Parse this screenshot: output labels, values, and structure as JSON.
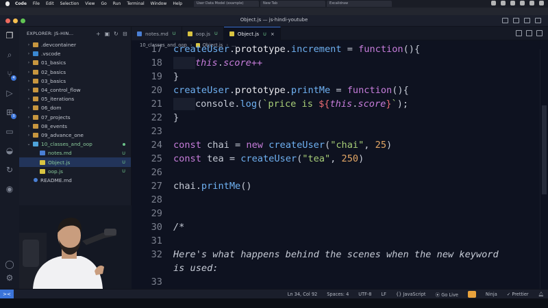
{
  "menubar": {
    "app": "Code",
    "items": [
      "File",
      "Edit",
      "Selection",
      "View",
      "Go",
      "Run",
      "Terminal",
      "Window",
      "Help"
    ],
    "browser_tabs": [
      "User Data Model (example)",
      "New Tab",
      "Excalidraw"
    ]
  },
  "window": {
    "title": "Object.js — js-hindi-youtube"
  },
  "colors": {
    "accent": "#3b74d9",
    "modified": "#6cc38a",
    "keyword": "#c77ddb",
    "function": "#6fb1f2",
    "string": "#a8cf78",
    "number": "#e3a765"
  },
  "activity": {
    "source_control_badge": "4",
    "extensions_badge": "3"
  },
  "explorer": {
    "title": "EXPLORER: JS-HIN...",
    "items": [
      {
        "label": ".devcontainer",
        "kind": "folder",
        "depth": 0
      },
      {
        "label": ".vscode",
        "kind": "folder-vscode",
        "depth": 0
      },
      {
        "label": "01_basics",
        "kind": "folder",
        "depth": 0
      },
      {
        "label": "02_basics",
        "kind": "folder",
        "depth": 0
      },
      {
        "label": "03_basics",
        "kind": "folder",
        "depth": 0
      },
      {
        "label": "04_control_flow",
        "kind": "folder",
        "depth": 0
      },
      {
        "label": "05_iterations",
        "kind": "folder",
        "depth": 0
      },
      {
        "label": "06_dom",
        "kind": "folder",
        "depth": 0
      },
      {
        "label": "07_projects",
        "kind": "folder",
        "depth": 0
      },
      {
        "label": "08_events",
        "kind": "folder",
        "depth": 0
      },
      {
        "label": "09_advance_one",
        "kind": "folder",
        "depth": 0
      },
      {
        "label": "10_classes_and_oop",
        "kind": "folder-open",
        "depth": 0
      },
      {
        "label": "notes.md",
        "kind": "md",
        "depth": 1,
        "status": "U"
      },
      {
        "label": "Object.js",
        "kind": "js",
        "depth": 1,
        "status": "U"
      },
      {
        "label": "oop.js",
        "kind": "js",
        "depth": 1,
        "status": "U"
      },
      {
        "label": "README.md",
        "kind": "readme",
        "depth": 0
      }
    ]
  },
  "tabs": [
    {
      "label": "notes.md",
      "status": "U"
    },
    {
      "label": "oop.js",
      "status": "U"
    },
    {
      "label": "Object.js",
      "status": "U",
      "close": "×"
    }
  ],
  "breadcrumb": {
    "folder": "10_classes_and_oop",
    "file": "Object.js",
    "more": "..."
  },
  "editor": {
    "lines": [
      {
        "n": "17",
        "tokens": [
          [
            "fn",
            "createUser"
          ],
          [
            "p",
            "."
          ],
          [
            "prop",
            "prototype"
          ],
          [
            "p",
            "."
          ],
          [
            "fn",
            "increment"
          ],
          [
            "p",
            " = "
          ],
          [
            "kw",
            "function"
          ],
          [
            "p",
            "(){"
          ]
        ]
      },
      {
        "n": "18",
        "indent": 1,
        "tokens": [
          [
            "this",
            "this"
          ],
          [
            "p",
            "."
          ],
          [
            "cmtit",
            "score++"
          ]
        ]
      },
      {
        "n": "19",
        "tokens": [
          [
            "p",
            "}"
          ]
        ]
      },
      {
        "n": "20",
        "tokens": [
          [
            "fn",
            "createUser"
          ],
          [
            "p",
            "."
          ],
          [
            "prop",
            "prototype"
          ],
          [
            "p",
            "."
          ],
          [
            "fn",
            "printMe"
          ],
          [
            "p",
            " = "
          ],
          [
            "kw",
            "function"
          ],
          [
            "p",
            "(){"
          ]
        ]
      },
      {
        "n": "21",
        "indent": 1,
        "tokens": [
          [
            "p",
            "console."
          ],
          [
            "fn",
            "log"
          ],
          [
            "p",
            "("
          ],
          [
            "str",
            "`price is "
          ],
          [
            "var",
            "${"
          ],
          [
            "this",
            "this"
          ],
          [
            "p",
            "."
          ],
          [
            "cmtit",
            "score"
          ],
          [
            "var",
            "}"
          ],
          [
            "str",
            "`"
          ],
          [
            "p",
            ");"
          ]
        ]
      },
      {
        "n": "22",
        "tokens": [
          [
            "p",
            "}"
          ]
        ]
      },
      {
        "n": "23",
        "tokens": []
      },
      {
        "n": "24",
        "tokens": [
          [
            "kw",
            "const "
          ],
          [
            "p",
            "chai = "
          ],
          [
            "kw",
            "new "
          ],
          [
            "fn",
            "createUser"
          ],
          [
            "p",
            "("
          ],
          [
            "str",
            "\"chai\""
          ],
          [
            "p",
            ", "
          ],
          [
            "num",
            "25"
          ],
          [
            "p",
            ")"
          ]
        ]
      },
      {
        "n": "25",
        "tokens": [
          [
            "kw",
            "const "
          ],
          [
            "p",
            "tea = "
          ],
          [
            "fn",
            "createUser"
          ],
          [
            "p",
            "("
          ],
          [
            "str",
            "\"tea\""
          ],
          [
            "p",
            ", "
          ],
          [
            "num",
            "250"
          ],
          [
            "p",
            ")"
          ]
        ]
      },
      {
        "n": "26",
        "tokens": []
      },
      {
        "n": "27",
        "tokens": [
          [
            "p",
            "chai."
          ],
          [
            "fn",
            "printMe"
          ],
          [
            "p",
            "()"
          ]
        ]
      },
      {
        "n": "28",
        "tokens": []
      },
      {
        "n": "29",
        "tokens": []
      },
      {
        "n": "30",
        "tokens": [
          [
            "cmt",
            "/*"
          ]
        ]
      },
      {
        "n": "31",
        "tokens": []
      },
      {
        "n": "32",
        "tokens": [
          [
            "cmt",
            "Here's what happens behind the scenes when the new keyword"
          ]
        ]
      },
      {
        "n": "",
        "tokens": [
          [
            "cmt",
            "is used:"
          ]
        ]
      },
      {
        "n": "33",
        "tokens": []
      }
    ]
  },
  "statusbar": {
    "remote_icon": "><",
    "position": "Ln 34, Col 92",
    "spaces": "Spaces: 4",
    "encoding": "UTF-8",
    "eol": "LF",
    "language": "{} JavaScript",
    "golive": "⦿ Go Live",
    "ninja": "Ninja",
    "prettier": "✓ Prettier"
  }
}
